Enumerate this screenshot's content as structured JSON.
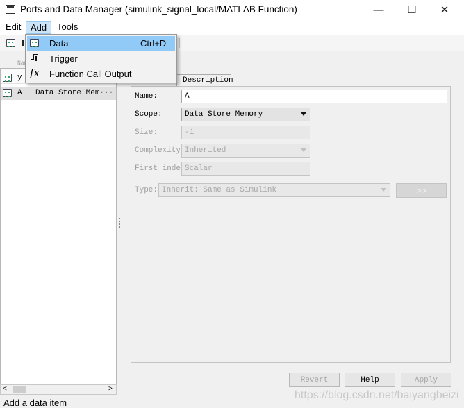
{
  "window": {
    "title": "Ports and Data Manager (simulink_signal_local/MATLAB Function)",
    "minimize_glyph": "—",
    "maximize_glyph": "☐",
    "close_glyph": "✕"
  },
  "menubar": {
    "items": [
      "Edit",
      "Add",
      "Tools"
    ],
    "active": "Add"
  },
  "add_menu": {
    "items": [
      {
        "label": "Data",
        "shortcut": "Ctrl+D",
        "icon": "data-icon",
        "highlighted": true
      },
      {
        "label": "Trigger",
        "shortcut": "",
        "icon": "trigger-icon"
      },
      {
        "label": "Function Call Output",
        "shortcut": "",
        "icon": "fx-icon"
      }
    ]
  },
  "list": {
    "header_fragment": "Nam",
    "rows": [
      {
        "name": "y",
        "scope": ""
      },
      {
        "name": "A",
        "scope": "Data Store Mem···"
      }
    ]
  },
  "tabs": {
    "visible": "Description"
  },
  "form": {
    "name_label": "Name:",
    "name_value": "A",
    "scope_label": "Scope:",
    "scope_value": "Data Store Memory",
    "size_label": "Size:",
    "size_value": "-1",
    "complexity_label": "Complexity:",
    "complexity_value": "Inherited",
    "first_index_label": "First index",
    "first_index_value": "Scalar",
    "type_label": "Type:",
    "type_value": "Inherit: Same as Simulink",
    "type_assistant_label": ">>"
  },
  "buttons": {
    "revert": "Revert",
    "help": "Help",
    "apply": "Apply"
  },
  "status": "Add a data item",
  "watermark": "https://blog.csdn.net/baiyangbeizi",
  "colors": {
    "menu_highlight": "#91c9f7",
    "menu_active": "#cce4f7",
    "selected_row": "#e0e0e0"
  }
}
